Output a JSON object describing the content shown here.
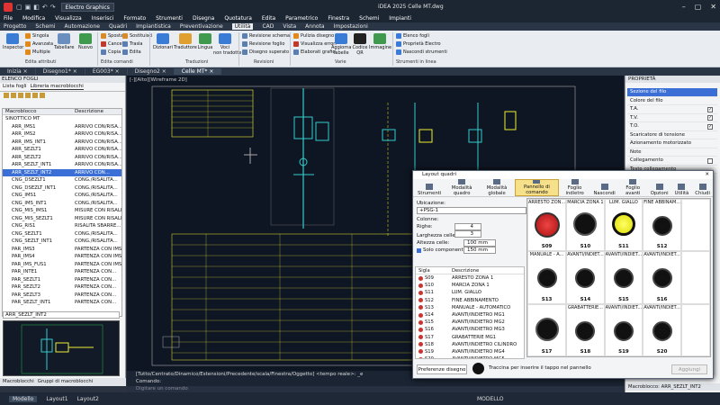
{
  "app": {
    "name": "Electro Graphics",
    "center_title": "iDEA 2025     Celle MT.dwg"
  },
  "menu": [
    "File",
    "Modifica",
    "Visualizza",
    "Inserisci",
    "Formato",
    "Strumenti",
    "Disegna",
    "Quotatura",
    "Edita",
    "Parametrico",
    "Finestra",
    "Schemi",
    "Impianti"
  ],
  "tabs": [
    {
      "label": "Progetto",
      "active": false
    },
    {
      "label": "Schemi",
      "active": false
    },
    {
      "label": "Automazione",
      "active": false
    },
    {
      "label": "Quadri",
      "active": false
    },
    {
      "label": "Impiantistica",
      "active": false
    },
    {
      "label": "Preventivazione",
      "active": false
    },
    {
      "label": "Utilità",
      "active": true
    },
    {
      "label": "CAD",
      "active": false
    },
    {
      "label": "Vista",
      "active": false
    },
    {
      "label": "Annota",
      "active": false
    },
    {
      "label": "Impostazioni",
      "active": false
    }
  ],
  "ribbon": {
    "inspector": "Inspector",
    "singola": "Singola",
    "avanzata": "Avanzata",
    "multiple": "Multiple",
    "tabellare": "Tabellare",
    "nuovo": "Nuovo",
    "sposta": "Sposta",
    "sostituisci": "Sostituisci",
    "cancella": "Cancella",
    "trasla": "Trasla",
    "copia": "Copia",
    "edita": "Edita",
    "dizionari": "Dizionari",
    "traduttore": "Traduttore",
    "lingua": "Lingua",
    "voci": "Voci\nnon tradotte",
    "rev_schema": "Revisione schema",
    "rev_foglio": "Revisione foglio",
    "disegno_sup": "Disegno superato",
    "pulizia": "Pulizia disegno",
    "vis_errori": "Visualizza errori",
    "elaborati": "Elaborati grafici",
    "aggiorna": "Aggiorna\ntabelle",
    "codice": "Codice\nQR",
    "immagine": "Immagine",
    "elenco": "Elenco fogli",
    "proprieta": "Proprietà Electro",
    "nascondi": "Nascondi strumenti",
    "g_edita": "Edita attributi",
    "g_comandi": "Edita comandi",
    "g_traduzioni": "Traduzioni",
    "g_revisioni": "Revisioni",
    "g_varie": "Varie",
    "g_strumenti": "Strumenti in linea"
  },
  "doc_tabs": [
    {
      "label": "Inizia",
      "active": false
    },
    {
      "label": "Disegno1*",
      "active": false
    },
    {
      "label": "EG003*",
      "active": false
    },
    {
      "label": "Disegno2",
      "active": false
    },
    {
      "label": "Celle MT*",
      "active": true
    }
  ],
  "left": {
    "title": "ELENCO FOGLI",
    "tab1": "Lista fogli",
    "tab2": "Libreria macroblocchi",
    "col1": "Macroblocco",
    "col2": "Descrizione",
    "rows": [
      {
        "n": "SINOTTICO MT",
        "d": "",
        "root": true
      },
      {
        "n": "ARR_IMS1",
        "d": "ARRIVO CON/RISA..."
      },
      {
        "n": "ARR_IMS2",
        "d": "ARRIVO CON/RISA..."
      },
      {
        "n": "ARR_IMS_INT1",
        "d": "ARRIVO CON/RISA..."
      },
      {
        "n": "ARR_SEZLT1",
        "d": "ARRIVO CON/RISA..."
      },
      {
        "n": "ARR_SEZLT2",
        "d": "ARRIVO CON/RISA..."
      },
      {
        "n": "ARR_SEZLT_INT1",
        "d": "ARRIVO CON/RISA..."
      },
      {
        "n": "ARR_SEZLT_INT2",
        "d": "ARRIVO CON...",
        "sel": true
      },
      {
        "n": "CNG_DSEZLT1",
        "d": "CONG./RISALITA..."
      },
      {
        "n": "CNG_DSEZLT_INT1",
        "d": "CONG./RISALITA..."
      },
      {
        "n": "CNG_IMS1",
        "d": "CONG./RISALITA..."
      },
      {
        "n": "CNG_IMS_INT1",
        "d": "CONG./RISALITA..."
      },
      {
        "n": "CNG_MIS_IMS1",
        "d": "MISURE CON RISALI..."
      },
      {
        "n": "CNG_MIS_SEZLT1",
        "d": "MISURE CON RISALI..."
      },
      {
        "n": "CNG_RIS1",
        "d": "RISALITA SBARRE..."
      },
      {
        "n": "CNG_SEZLT1",
        "d": "CONG./RISALITA..."
      },
      {
        "n": "CNG_SEZLT_INT1",
        "d": "CONG./RISALITA..."
      },
      {
        "n": "PAR_IMS3",
        "d": "PARTENZA CON IMS..."
      },
      {
        "n": "PAR_IMS4",
        "d": "PARTENZA CON IMS..."
      },
      {
        "n": "PAR_IMS_FUS1",
        "d": "PARTENZA CON IMS..."
      },
      {
        "n": "PAR_INTE1",
        "d": "PARTENZA CON..."
      },
      {
        "n": "PAR_SEZLT1",
        "d": "PARTENZA CON..."
      },
      {
        "n": "PAR_SEZLT2",
        "d": "PARTENZA CON..."
      },
      {
        "n": "PAR_SEZLT3",
        "d": "PARTENZA CON..."
      },
      {
        "n": "PAR_SEZLT_INT1",
        "d": "PARTENZA CON..."
      }
    ],
    "preview_sel": "ARR_SEZLT_INT2",
    "bottom_tab1": "Macroblocchi",
    "bottom_tab2": "Gruppi di macroblocchi"
  },
  "canvas": {
    "label": "[-][Alto][Wireframe 2D]"
  },
  "command": {
    "line1": "[Tutto/Centrato/Dinamico/Estensioni/Precedente/scala/Finestra/Oggetto] <tempo reale>: _e",
    "line2": "Comando:",
    "placeholder": "Digitare un comando"
  },
  "status": [
    {
      "label": "Modello",
      "active": true
    },
    {
      "label": "Layout1",
      "active": false
    },
    {
      "label": "Layout2",
      "active": false
    }
  ],
  "status_right": "MODELLO",
  "right": {
    "title": "PROPRIETÀ",
    "rows": [
      {
        "l": "Sezione del filo",
        "c": "",
        "hl": true
      },
      {
        "l": "Colore del filo",
        "c": ""
      },
      {
        "l": "T.A.",
        "c": "✓"
      },
      {
        "l": "T.V.",
        "c": "✓"
      },
      {
        "l": "T.O.",
        "c": "✓"
      },
      {
        "l": "Scaricatore di tensione",
        "c": ""
      },
      {
        "l": "Azionamento motorizzato",
        "c": ""
      },
      {
        "l": "Note",
        "c": ""
      },
      {
        "l": "Collegamento",
        "c": "□"
      },
      {
        "l": "Testo collegamento",
        "c": ""
      }
    ],
    "footer": "Macroblocco: ARR_SEZLT_INT2"
  },
  "dialog": {
    "title": "Layout quadri",
    "toolbar": [
      {
        "label": "Strumenti",
        "active": false
      },
      {
        "label": "Modalità quadro",
        "active": false
      },
      {
        "label": "Modalità globale",
        "active": false
      },
      {
        "label": "Pannello di comando",
        "active": true
      },
      {
        "label": "Foglio indietro",
        "active": false
      },
      {
        "label": "Nascondi",
        "active": false
      },
      {
        "label": "Foglio avanti",
        "active": false
      },
      {
        "label": "Opzioni",
        "active": false
      },
      {
        "label": "Utilità",
        "active": false
      },
      {
        "label": "Chiudi",
        "active": false
      }
    ],
    "ubicazione_l": "Ubicazione:",
    "ubicazione": "+PSG-1",
    "colonne_l": "Colonne:",
    "colonne": "4",
    "righe_l": "Righe:",
    "righe": "3",
    "larghezza_l": "Larghezza celle:",
    "larghezza": "100 mm",
    "altezza_l": "Altezza celle:",
    "altezza": "150 mm",
    "solo": "Solo componenti predisposti",
    "col_sigla": "Sigla",
    "col_desc": "Descrizione",
    "signals": [
      {
        "s": "S09",
        "d": "ARRESTO ZONA 1"
      },
      {
        "s": "S10",
        "d": "MARCIA ZONA 1"
      },
      {
        "s": "S11",
        "d": "LUM. GIALLO"
      },
      {
        "s": "S12",
        "d": "FINE ABBINAMENTO"
      },
      {
        "s": "S13",
        "d": "MANUALE - AUTOMATICO"
      },
      {
        "s": "S14",
        "d": "AVANTI/INDIETRO MG1"
      },
      {
        "s": "S15",
        "d": "AVANTI/INDIETRO MG2"
      },
      {
        "s": "S16",
        "d": "AVANTI/INDIETRO MG3"
      },
      {
        "s": "S17",
        "d": "GRABATTERIE MG1"
      },
      {
        "s": "S18",
        "d": "AVANTI/INDIETRO CILINDRO"
      },
      {
        "s": "S19",
        "d": "AVANTI/INDIETRO MG4"
      },
      {
        "s": "S20",
        "d": "AVANTI/INDIETRO MG5"
      }
    ],
    "cells": [
      {
        "t": "ARRESTO ZON...",
        "k": "S09",
        "type": "red"
      },
      {
        "t": "MARCIA ZONA 1",
        "k": "S10",
        "type": "black"
      },
      {
        "t": "LUM. GIALLO",
        "k": "S11",
        "type": "yellow"
      },
      {
        "t": "FINE ABBINAM...",
        "k": "S12",
        "type": "sel"
      },
      {
        "t": "",
        "k": "",
        "type": "empty"
      },
      {
        "t": "MANUALE - A...",
        "k": "S13",
        "type": "sel"
      },
      {
        "t": "AVANTI/INDIET...",
        "k": "S14",
        "type": "sel"
      },
      {
        "t": "AVANTI/INDIET...",
        "k": "S15",
        "type": "sel"
      },
      {
        "t": "AVANTI/INDIET...",
        "k": "S16",
        "type": "sel"
      },
      {
        "t": "",
        "k": "",
        "type": "empty"
      },
      {
        "t": "",
        "k": "S17",
        "type": "black"
      },
      {
        "t": "GRABATTERIE...",
        "k": "S18",
        "type": "sel"
      },
      {
        "t": "AVANTI/INDIET...",
        "k": "S19",
        "type": "sel"
      },
      {
        "t": "AVANTI/INDIET...",
        "k": "S20",
        "type": "sel"
      },
      {
        "t": "",
        "k": "",
        "type": "empty"
      }
    ],
    "pref": "Preferenze disegno",
    "hint": "Traccina per inserire il tappo nel pannello",
    "aggiungi": "Aggiungi"
  }
}
